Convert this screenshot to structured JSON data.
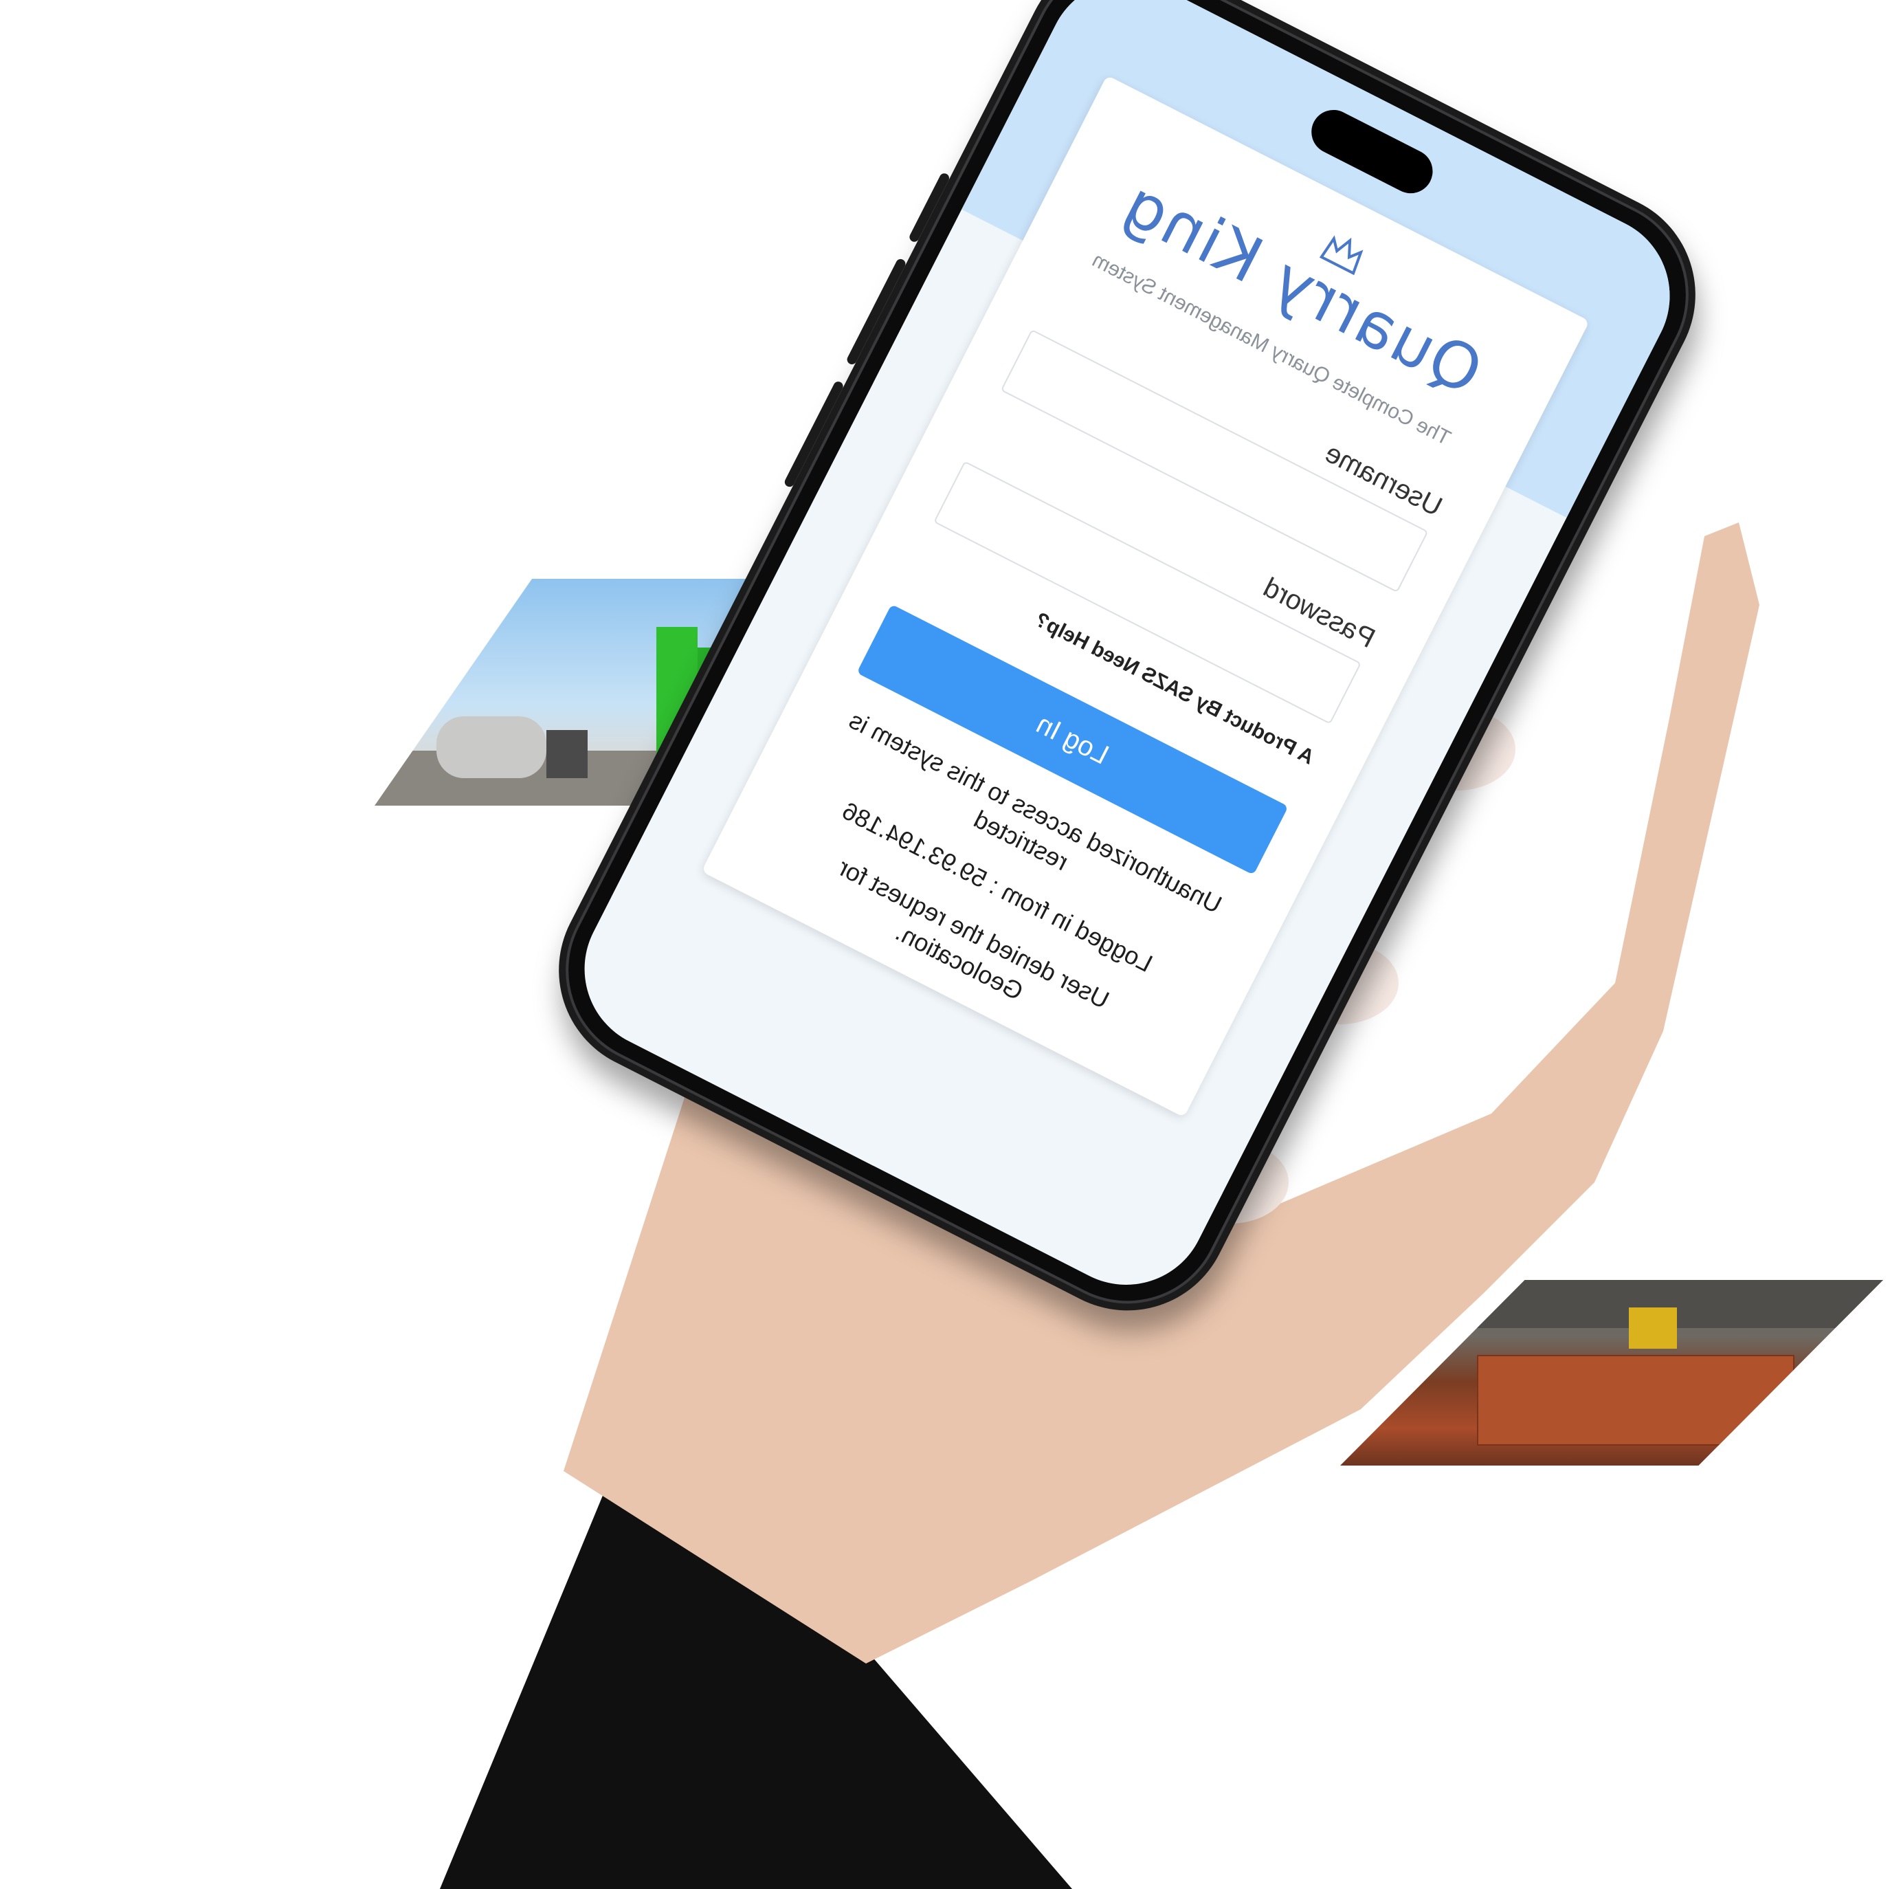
{
  "login": {
    "brand": "Quarry King",
    "tagline": "The Complete Quarry Management System",
    "username_label": "Username",
    "password_label": "Password",
    "footer_link": "A Product By SAZS Need Help?",
    "login_button": "Log In",
    "notices": [
      "Unauthorized access to this system is restricted",
      "Logged in from : 59.93.194.186",
      "User denied the request for Geolocation."
    ]
  },
  "colors": {
    "brand_blue": "#4a78c8",
    "button_blue": "#3d97f5",
    "screen_header": "#c9e3fa"
  },
  "images": {
    "left_tile": "industrial-silos-photo",
    "right_tile": "brick-warehouse-photo"
  }
}
